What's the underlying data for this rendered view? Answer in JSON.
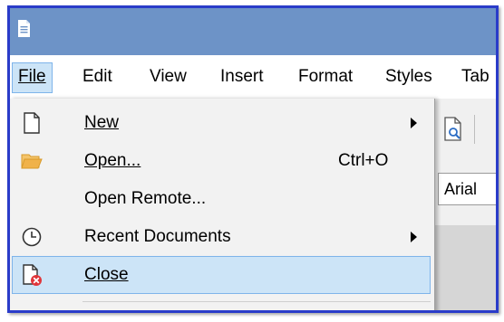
{
  "menubar": {
    "items": [
      {
        "label": "File",
        "active": true
      },
      {
        "label": "Edit"
      },
      {
        "label": "View"
      },
      {
        "label": "Insert"
      },
      {
        "label": "Format"
      },
      {
        "label": "Styles"
      },
      {
        "label": "Tab"
      }
    ]
  },
  "file_menu": {
    "items": [
      {
        "label": "New",
        "icon": "new-document-icon",
        "submenu": true
      },
      {
        "label": "Open...",
        "icon": "folder-open-icon",
        "shortcut": "Ctrl+O"
      },
      {
        "label": "Open Remote..."
      },
      {
        "label": "Recent Documents",
        "icon": "clock-icon",
        "submenu": true
      },
      {
        "label": "Close",
        "icon": "close-document-icon",
        "highlighted": true
      }
    ]
  },
  "toolbar": {
    "font_name": "Arial"
  },
  "colors": {
    "titlebar": "#6d93c7",
    "highlight": "#cce4f7",
    "highlight_border": "#7eb4ea",
    "frame_border": "#2a3cc9",
    "folder": "#f0b24a",
    "close_badge": "#e0353a"
  }
}
